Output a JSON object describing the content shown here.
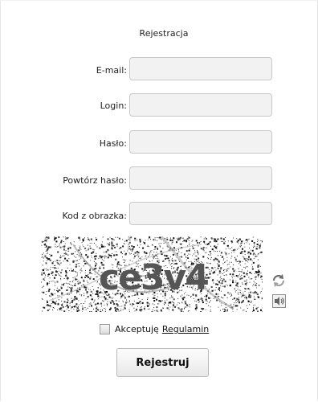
{
  "form": {
    "title": "Rejestracja",
    "fields": [
      {
        "label": "E-mail:",
        "value": "",
        "placeholder": ""
      },
      {
        "label": "Login:",
        "value": "",
        "placeholder": ""
      },
      {
        "label": "Hasło:",
        "value": "",
        "placeholder": ""
      },
      {
        "label": "Powtórz hasło:",
        "value": "",
        "placeholder": ""
      },
      {
        "label": "Kod z obrazka:",
        "value": "",
        "placeholder": ""
      }
    ],
    "captcha": {
      "text": "ce3v4",
      "refresh_icon": "refresh-icon",
      "audio_icon": "audio-icon"
    },
    "accept": {
      "text": "Akceptuję",
      "link": "Regulamin",
      "checked": false
    },
    "submit_label": "Rejestruj"
  }
}
